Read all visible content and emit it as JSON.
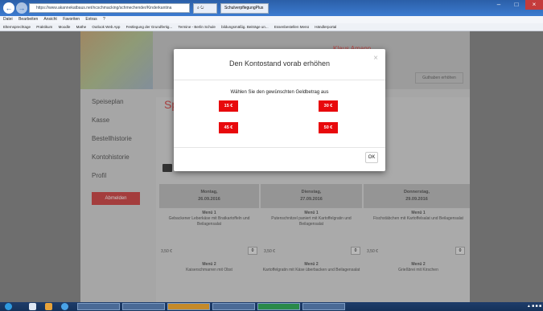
{
  "browser": {
    "address": "https://www.akannekatbaus.net/ncschmacking/schmechender/Kinderkantina",
    "tabs": [
      "SchulverpflegungPlus"
    ],
    "menubar": [
      "Datei",
      "Bearbeiten",
      "Ansicht",
      "Favoriten",
      "Extras",
      "?"
    ],
    "favorites": [
      "Elternsprechtage",
      "Praktikum",
      "Moodle",
      "Mathe",
      "Outlook Web App",
      "Festlegung der Grundfertig...",
      "Termine - Berlin Schule",
      "bildungsmäßig. Beiträge un...",
      "Essenbestellen Menü",
      "Händlerportal"
    ]
  },
  "site": {
    "username": "Klaus Amann",
    "guthaben_button": "Guthaben erhöhen",
    "page_title": "Sp",
    "sidebar": [
      "Speiseplan",
      "Kasse",
      "Bestellhistorie",
      "Kontohistorie",
      "Profil"
    ],
    "logout_button": "Abmelden",
    "days": [
      {
        "weekday": "Montag,",
        "date": "26.09.2016"
      },
      {
        "weekday": "Dienstag,",
        "date": "27.09.2016"
      },
      {
        "weekday": "Donnerstag,",
        "date": "29.09.2016"
      }
    ],
    "menus_row1": [
      {
        "title": "Menü 1",
        "desc": "Gebackener Leberkäse mit Bratkartoffeln und Beilagensalat"
      },
      {
        "title": "Menü 1",
        "desc": "Putenschnitzel paniert mit Kartoffelgratin und Beilagensalat"
      },
      {
        "title": "Menü 1",
        "desc": "Fischstäbchen mit Kartoffelsalat und Beilagensalat"
      }
    ],
    "prices": [
      "3,50 €",
      "3,50 €",
      "3,50 €"
    ],
    "qty": "0",
    "menus_row2": [
      {
        "title": "Menü 2",
        "desc": "Kaiserschmarren mit Obst"
      },
      {
        "title": "Menü 2",
        "desc": "Kartoffelgratin mit Käse überbacken und Beilagensalat"
      },
      {
        "title": "Menü 2",
        "desc": "Grießbrei mit Kirschen"
      }
    ]
  },
  "modal": {
    "title": "Den Kontostand vorab erhöhen",
    "close": "×",
    "prompt": "Wählen Sie den gewünschten Geldbetrag aus",
    "amounts": [
      "15 €",
      "30 €",
      "45 €",
      "50 €"
    ],
    "ok_label": "OK",
    "accent_color": "#e8090c"
  },
  "window_controls": [
    "–",
    "□",
    "×"
  ]
}
